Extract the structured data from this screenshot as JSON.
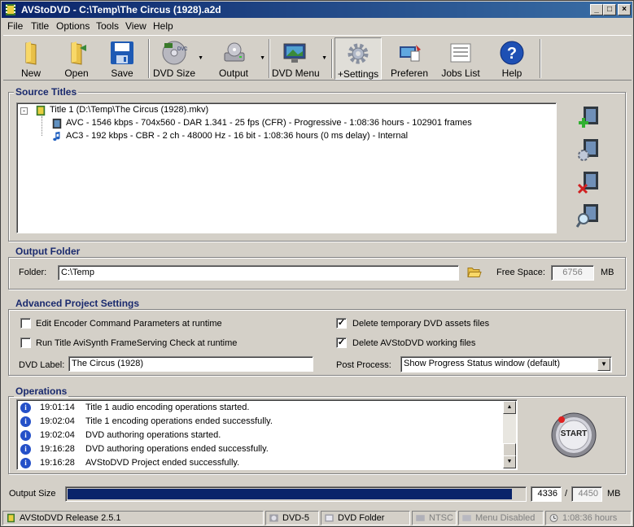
{
  "window": {
    "title": "AVStoDVD - C:\\Temp\\The Circus (1928).a2d",
    "minimize": "_",
    "maximize": "□",
    "close": "×"
  },
  "menu": [
    "File",
    "Title",
    "Options",
    "Tools",
    "View",
    "Help"
  ],
  "toolbar": {
    "new": "New",
    "open": "Open",
    "save": "Save",
    "dvd_size": "DVD Size",
    "output": "Output",
    "dvd_menu": "DVD Menu",
    "settings": "+Settings",
    "preferences": "Preferen",
    "jobs_list": "Jobs List",
    "help": "Help"
  },
  "source_titles": {
    "label": "Source Titles",
    "title1": "Title 1 (D:\\Temp\\The Circus (1928).mkv)",
    "video": "AVC - 1546 kbps - 704x560 - DAR 1.341 - 25 fps (CFR) - Progressive - 1:08:36 hours - 102901 frames",
    "audio": "AC3 - 192 kbps - CBR - 2 ch - 48000 Hz - 16 bit - 1:08:36 hours (0 ms delay) - Internal"
  },
  "output_folder": {
    "label": "Output Folder",
    "folder_label": "Folder:",
    "folder_value": "C:\\Temp",
    "free_space_label": "Free Space:",
    "free_space_value": "6756",
    "unit": "MB"
  },
  "advanced": {
    "label": "Advanced Project Settings",
    "edit_encoder": "Edit Encoder Command Parameters at runtime",
    "run_check": "Run Title AviSynth FrameServing Check at runtime",
    "delete_temp": "Delete temporary DVD assets files",
    "delete_working": "Delete AVStoDVD working files",
    "dvd_label_label": "DVD Label:",
    "dvd_label_value": "The Circus (1928)",
    "post_process_label": "Post Process:",
    "post_process_value": "Show Progress Status window (default)",
    "check_mark": "✓"
  },
  "operations": {
    "label": "Operations",
    "info": "i",
    "rows": [
      {
        "time": "19:01:14",
        "msg": "Title 1 audio encoding operations started."
      },
      {
        "time": "19:02:04",
        "msg": "Title 1 encoding operations ended successfully."
      },
      {
        "time": "19:02:04",
        "msg": "DVD authoring operations started."
      },
      {
        "time": "19:16:28",
        "msg": "DVD authoring operations ended successfully."
      },
      {
        "time": "19:16:28",
        "msg": "AVStoDVD Project ended successfully."
      }
    ],
    "start": "START"
  },
  "output_size": {
    "label": "Output Size",
    "used": "4336",
    "slash": "/",
    "total": "4450",
    "unit": "MB",
    "fraction": 0.974
  },
  "status": {
    "release": "AVStoDVD Release 2.5.1",
    "dvd": "DVD-5",
    "dvd_folder": "DVD Folder",
    "ntsc": "NTSC",
    "menu": "Menu Disabled",
    "duration": "1:08:36 hours"
  }
}
